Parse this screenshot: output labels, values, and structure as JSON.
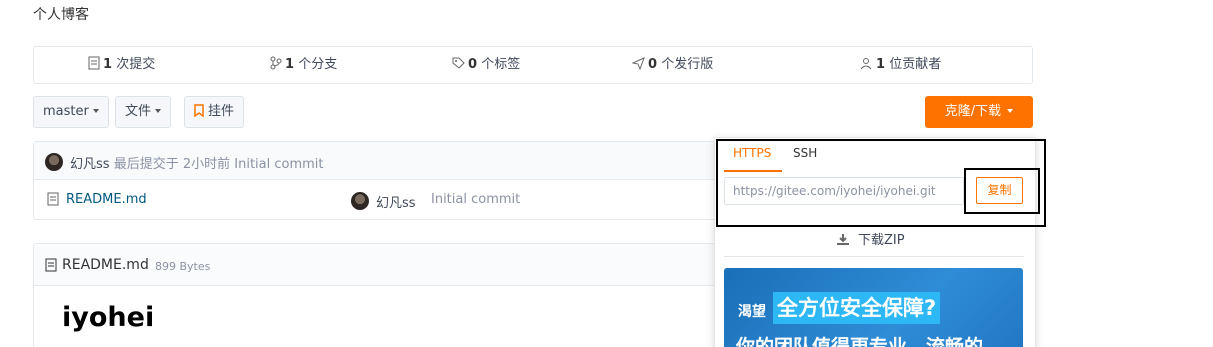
{
  "repo": {
    "description": "个人博客"
  },
  "stats": [
    {
      "icon": "commit-icon",
      "count": "1",
      "label": "次提交"
    },
    {
      "icon": "branch-icon",
      "count": "1",
      "label": "个分支"
    },
    {
      "icon": "tag-icon",
      "count": "0",
      "label": "个标签"
    },
    {
      "icon": "release-icon",
      "count": "0",
      "label": "个发行版"
    },
    {
      "icon": "contributors-icon",
      "count": "1",
      "label": "位贡献者"
    }
  ],
  "toolbar": {
    "branch": "master",
    "files": "文件",
    "widget": "挂件",
    "clone": "克隆/下载"
  },
  "commit": {
    "author": "幻凡ss",
    "prefix": "最后提交于",
    "time": "2小时前",
    "message": "Initial commit"
  },
  "files": [
    {
      "name": "README.md",
      "author": "幻凡ss",
      "message": "Initial commit"
    }
  ],
  "readme": {
    "filename": "README.md",
    "size": "899 Bytes",
    "heading": "iyohei"
  },
  "clone_panel": {
    "tabs": [
      "HTTPS",
      "SSH"
    ],
    "active_tab": "HTTPS",
    "url": "https://gitee.com/iyohei/iyohei.git",
    "copy": "复制",
    "download": "下载ZIP"
  },
  "ad": {
    "small": "渴望",
    "big": "全方位安全保障?",
    "line2": "你的团队值得更专业、流畅的"
  },
  "colors": {
    "accent": "#fe7300",
    "ad_bg": "#1a6fb8",
    "ad_highlight": "#2db7f5"
  }
}
